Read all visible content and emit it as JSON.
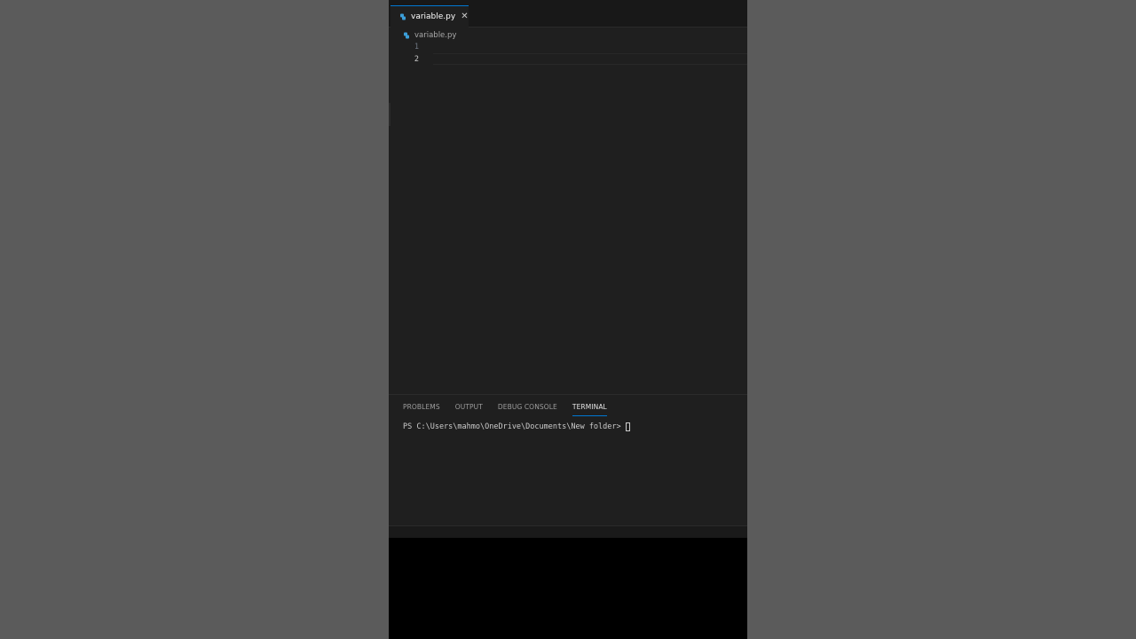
{
  "colors": {
    "background_outer": "#5a5a5a",
    "editor_bg": "#1f1f1f",
    "tab_accent": "#0078d4",
    "python_icon": "#3b9ed8"
  },
  "editor": {
    "tab": {
      "label": "variable.py",
      "icon": "python-file-icon",
      "close_glyph": "✕"
    },
    "breadcrumb": {
      "label": "variable.py",
      "icon": "python-file-icon"
    },
    "line_numbers": [
      "1",
      "2"
    ]
  },
  "panel": {
    "tabs": [
      {
        "label": "PROBLEMS"
      },
      {
        "label": "OUTPUT"
      },
      {
        "label": "DEBUG CONSOLE"
      },
      {
        "label": "TERMINAL",
        "active": true
      }
    ],
    "terminal": {
      "prompt": "PS C:\\Users\\mahmo\\OneDrive\\Documents\\New folder>"
    }
  }
}
